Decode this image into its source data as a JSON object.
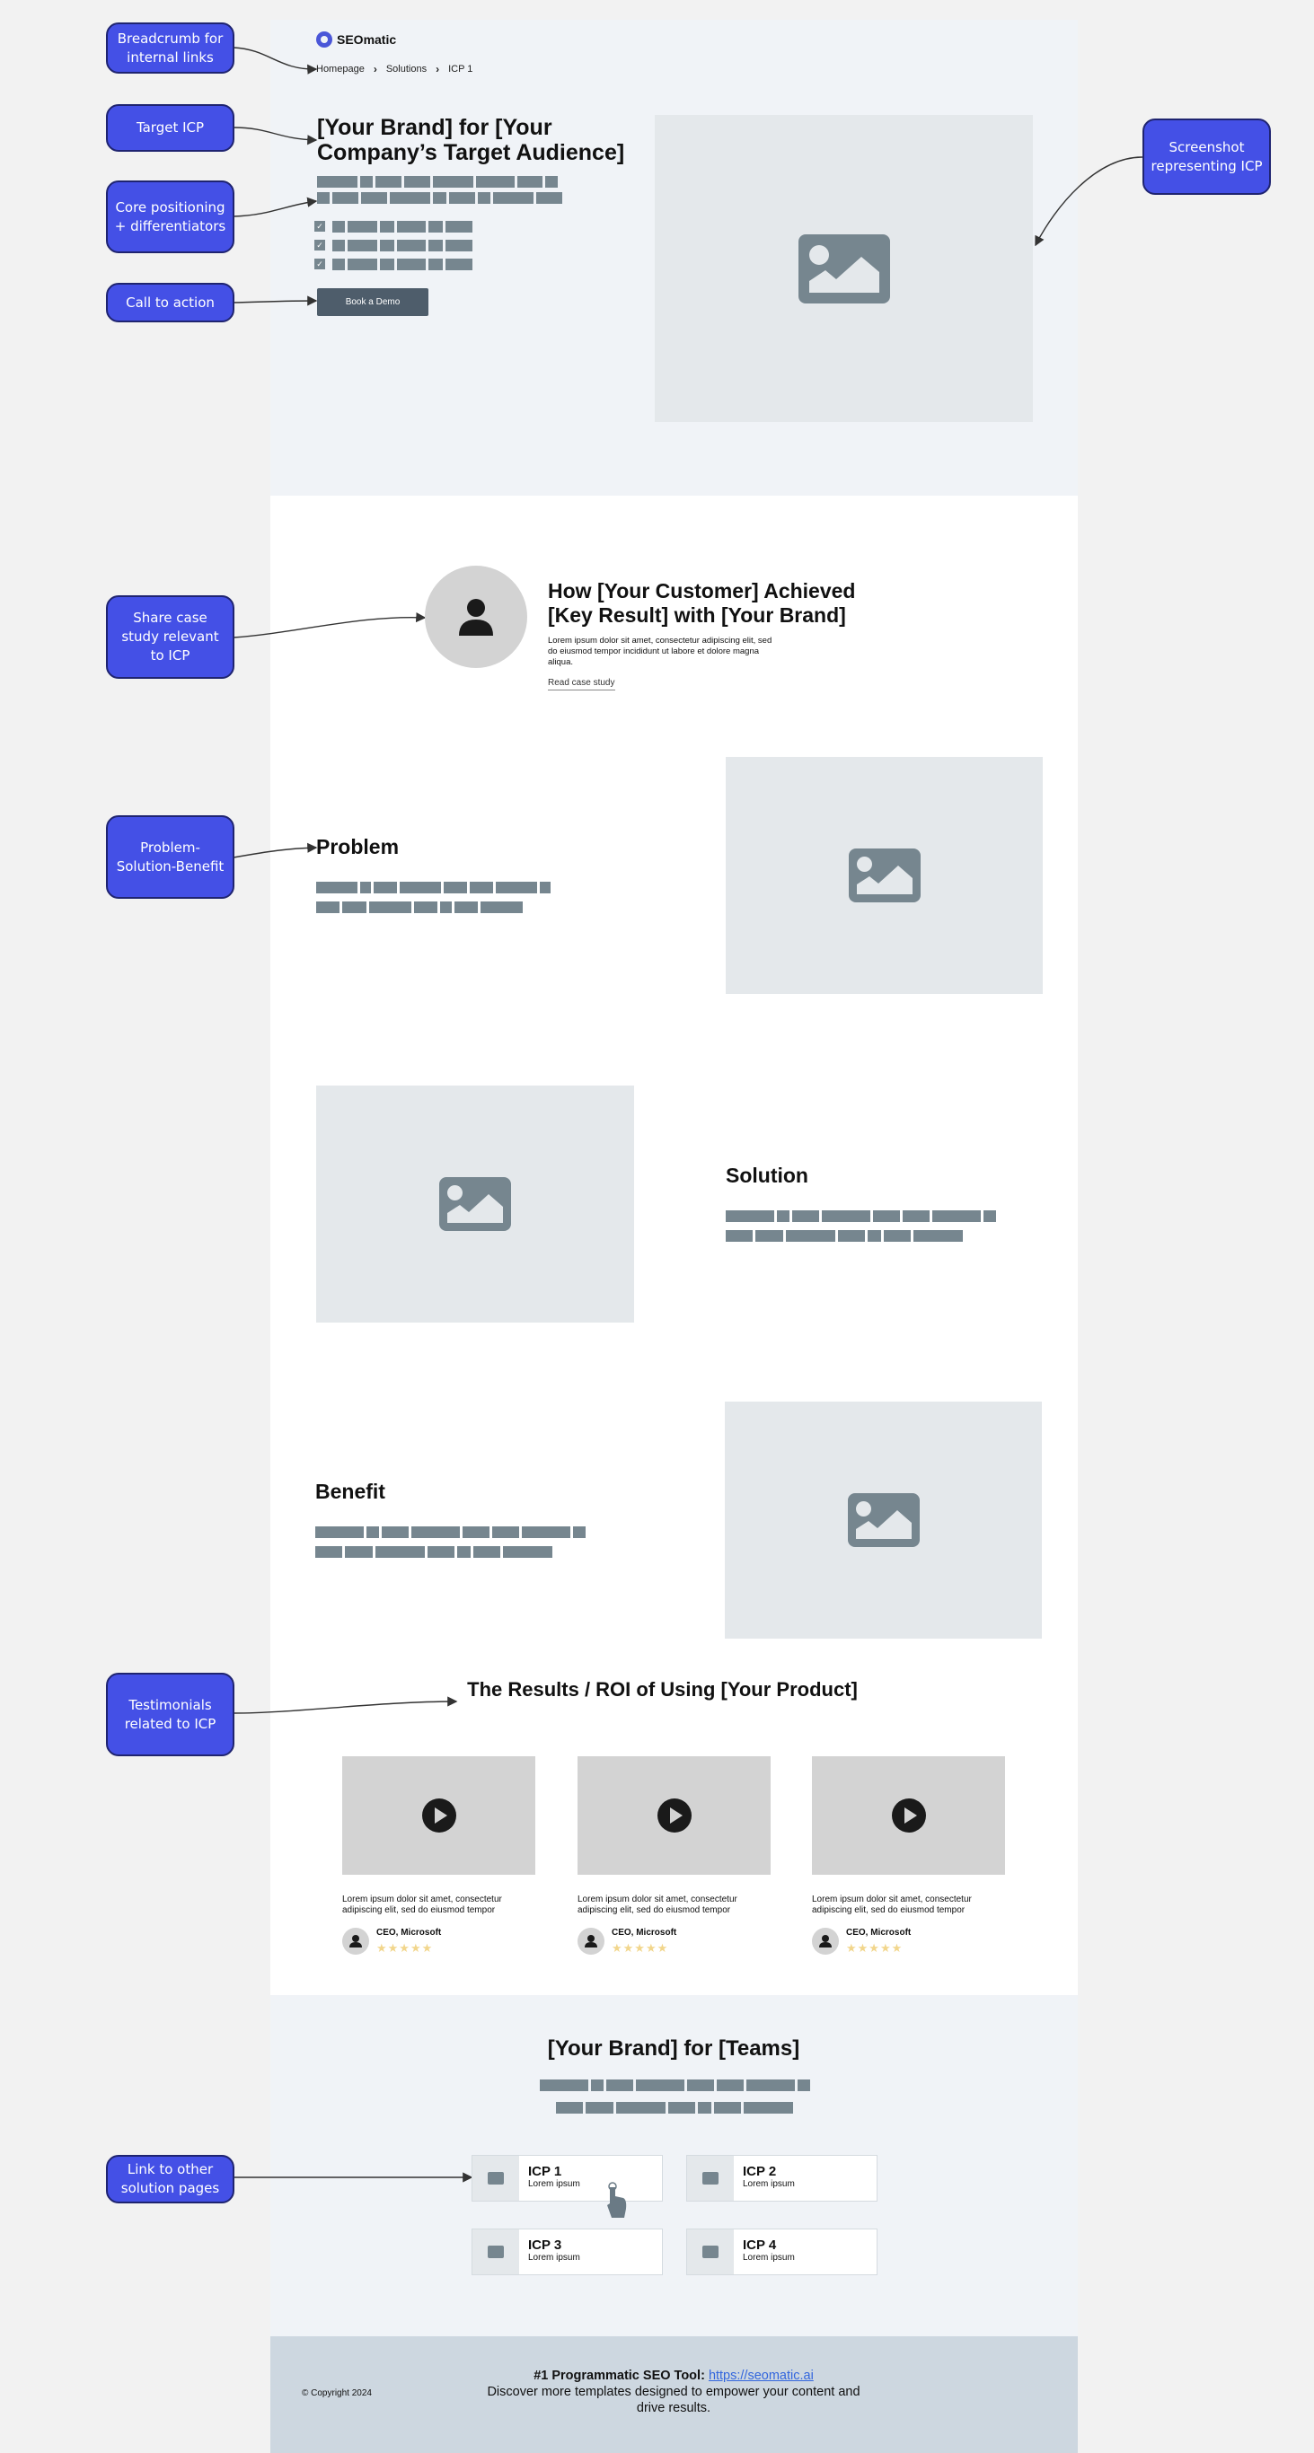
{
  "annotations": [
    {
      "id": "breadcrumb",
      "label": "Breadcrumb for internal links"
    },
    {
      "id": "target-icp",
      "label": "Target ICP"
    },
    {
      "id": "core-positioning",
      "label": "Core positioning + differentiators"
    },
    {
      "id": "cta",
      "label": "Call to action"
    },
    {
      "id": "screenshot",
      "label": "Screenshot representing ICP"
    },
    {
      "id": "case-study",
      "label": "Share case study relevant to ICP"
    },
    {
      "id": "psb",
      "label": "Problem-Solution-Benefit"
    },
    {
      "id": "testimonials",
      "label": "Testimonials related to ICP"
    },
    {
      "id": "links",
      "label": "Link to other solution pages"
    }
  ],
  "header": {
    "logo_text": "SEOmatic",
    "breadcrumb": [
      "Homepage",
      "Solutions",
      "ICP 1"
    ],
    "separator_icon": "chevron-right-icon"
  },
  "hero": {
    "title": "[Your Brand] for [Your Company’s Target Audience]",
    "checklist_count": 3,
    "cta_label": "Book a Demo",
    "image_icon": "image-placeholder-icon"
  },
  "case_study": {
    "avatar_icon": "user-icon",
    "title": "How [Your Customer] Achieved [Key Result] with [Your Brand]",
    "body": "Lorem ipsum dolor sit amet, consectetur adipiscing elit, sed do eiusmod tempor incididunt ut labore et dolore magna aliqua.",
    "link_label": "Read case study"
  },
  "sections": {
    "problem": {
      "title": "Problem"
    },
    "solution": {
      "title": "Solution"
    },
    "benefit": {
      "title": "Benefit"
    }
  },
  "results": {
    "title": "The Results / ROI of Using [Your Product]",
    "testimonials": [
      {
        "quote": "Lorem ipsum dolor sit amet, consectetur adipiscing elit, sed do eiusmod tempor",
        "author": "CEO, Microsoft",
        "rating": 5,
        "rating_max": 5
      },
      {
        "quote": "Lorem ipsum dolor sit amet, consectetur adipiscing elit, sed do eiusmod tempor",
        "author": "CEO, Microsoft",
        "rating": 5,
        "rating_max": 5
      },
      {
        "quote": "Lorem ipsum dolor sit amet, consectetur adipiscing elit, sed do eiusmod tempor",
        "author": "CEO, Microsoft",
        "rating": 5,
        "rating_max": 5
      }
    ],
    "star_glyph": "★★★★★"
  },
  "teams": {
    "title": "[Your Brand] for [Teams]",
    "cards": [
      {
        "title": "ICP 1",
        "subtitle": "Lorem ipsum"
      },
      {
        "title": "ICP 2",
        "subtitle": "Lorem ipsum"
      },
      {
        "title": "ICP 3",
        "subtitle": "Lorem ipsum"
      },
      {
        "title": "ICP 4",
        "subtitle": "Lorem ipsum"
      }
    ]
  },
  "footer": {
    "copyright": "© Copyright 2024",
    "tagline_bold": "#1 Programmatic SEO Tool:",
    "link": "https://seomatic.ai",
    "description": "Discover more templates designed to empower your content and drive results."
  },
  "colors": {
    "annotation": "#4450e6",
    "placeholder_bar": "#76868f",
    "hero_bg": "#f0f3f7",
    "footer_bg": "#cdd7e0",
    "star": "#f2d68c",
    "link": "#3366dd"
  }
}
